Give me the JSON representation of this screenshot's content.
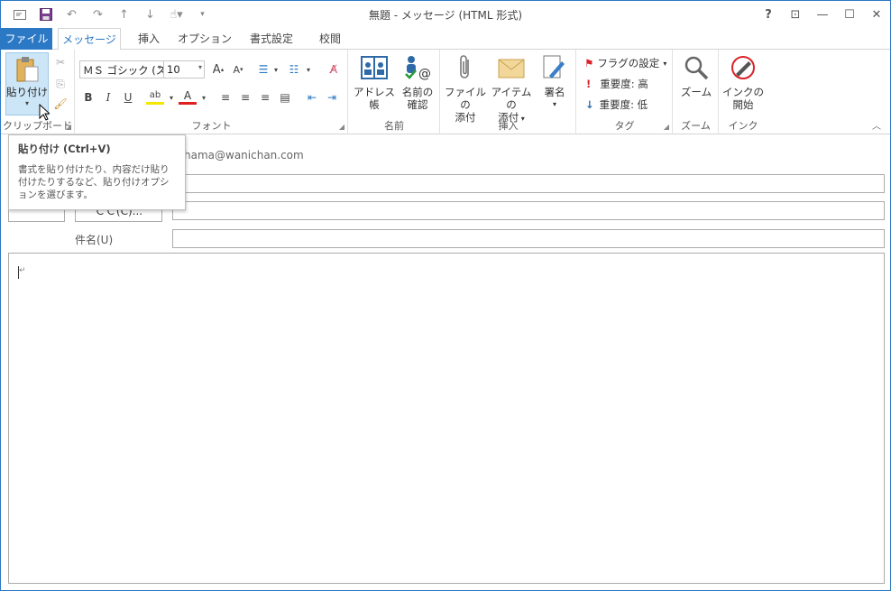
{
  "window": {
    "title": "無題 - メッセージ (HTML 形式)",
    "accent": "#2b78c5"
  },
  "qat": [
    "mail-icon",
    "save-icon",
    "undo-icon",
    "redo-icon",
    "up-icon",
    "down-icon",
    "touch-mode-icon",
    "customize-icon"
  ],
  "win_buttons": {
    "help": "?",
    "restore_ribbon": "⊡",
    "minimize": "—",
    "maximize": "☐",
    "close": "✕"
  },
  "tabs": [
    {
      "label": "ファイル"
    },
    {
      "label": "メッセージ"
    },
    {
      "label": "挿入"
    },
    {
      "label": "オプション"
    },
    {
      "label": "書式設定"
    },
    {
      "label": "校閲"
    }
  ],
  "ribbon": {
    "clipboard": {
      "paste": "貼り付け",
      "label": "クリップボード"
    },
    "font": {
      "font_name": "ＭＳ ゴシック (ス",
      "font_size": "10",
      "bold": "B",
      "italic": "I",
      "underline": "U",
      "label": "フォント"
    },
    "names": {
      "address_book": "アドレス帳",
      "check_names_1": "名前の",
      "check_names_2": "確認",
      "label": "名前"
    },
    "include": {
      "attach_file_1": "ファイルの",
      "attach_file_2": "添付",
      "attach_item_1": "アイテムの",
      "attach_item_2": "添付",
      "signature": "署名",
      "label": "挿入"
    },
    "tags": {
      "follow_up": "フラグの設定",
      "high_importance": "重要度: 高",
      "low_importance": "重要度: 低",
      "label": "タグ"
    },
    "zoom": {
      "zoom": "ズーム",
      "label": "ズーム"
    },
    "ink": {
      "start_inking_1": "インクの",
      "start_inking_2": "開始",
      "label": "インク"
    }
  },
  "form": {
    "from_value": "hama@wanichan.com",
    "cc_button": "ＣＣ(C)...",
    "subject_label": "件名(U)"
  },
  "tooltip": {
    "title": "貼り付け (Ctrl+V)",
    "body": "書式を貼り付けたり、内容だけ貼り付けたりするなど、貼り付けオプションを選びます。"
  },
  "body": {
    "mark": "↵"
  }
}
